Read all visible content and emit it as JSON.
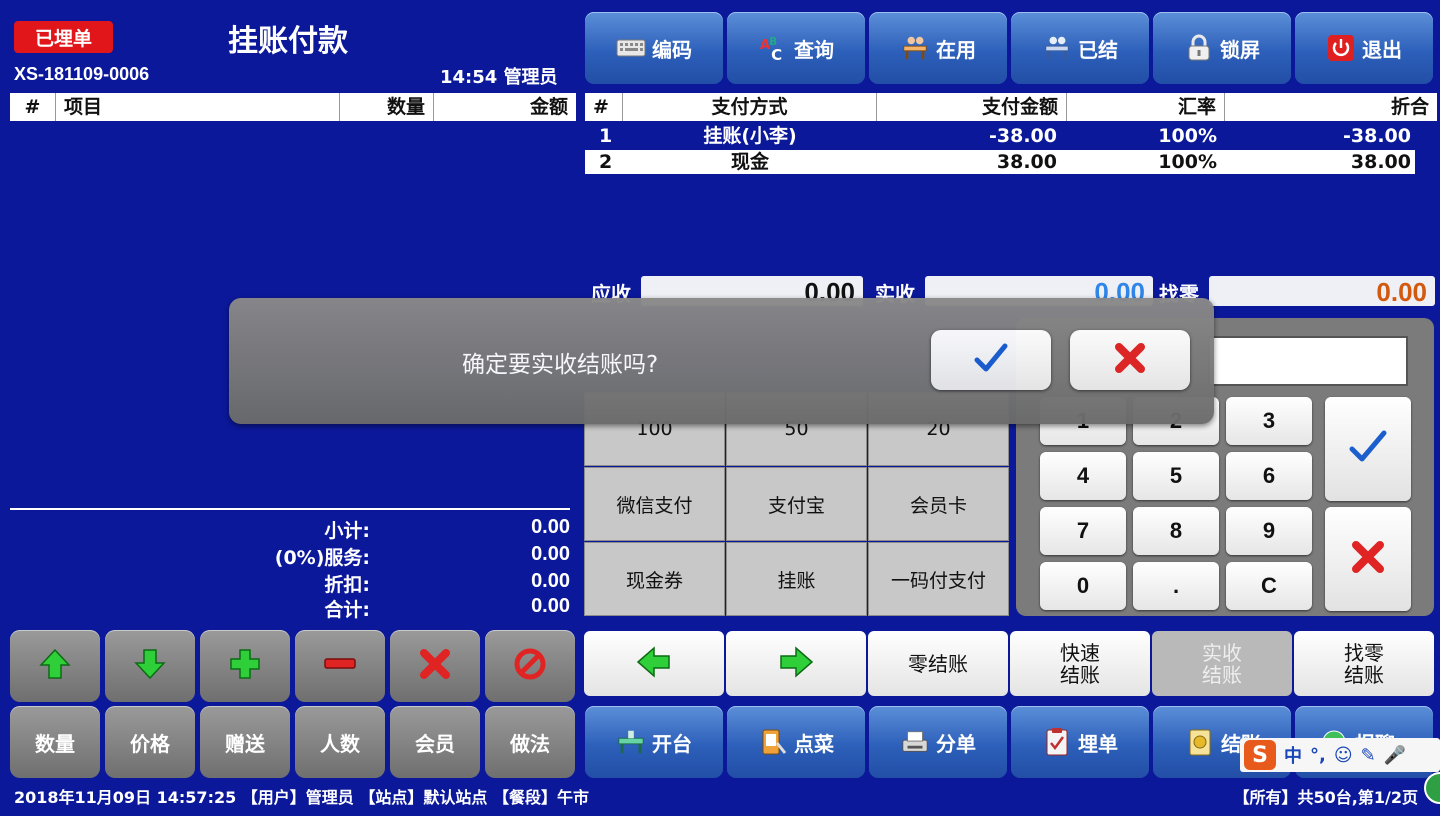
{
  "header": {
    "status_badge": "已埋单",
    "title": "挂账付款",
    "order_no": "XS-181109-0006",
    "time_user": "14:54 管理员"
  },
  "toolbar": [
    {
      "label": "编码",
      "icon": "keyboard-icon"
    },
    {
      "label": "查询",
      "icon": "abc-search-icon"
    },
    {
      "label": "在用",
      "icon": "table-in-use-icon"
    },
    {
      "label": "已结",
      "icon": "table-settled-icon"
    },
    {
      "label": "锁屏",
      "icon": "lock-icon"
    },
    {
      "label": "退出",
      "icon": "power-icon"
    }
  ],
  "item_table": {
    "columns": [
      "#",
      "项目",
      "数量",
      "金额"
    ]
  },
  "payment_table": {
    "columns": [
      "#",
      "支付方式",
      "支付金额",
      "汇率",
      "折合"
    ],
    "rows": [
      {
        "no": "1",
        "method": "挂账(小李)",
        "amount": "-38.00",
        "rate": "100%",
        "converted": "-38.00"
      },
      {
        "no": "2",
        "method": "现金",
        "amount": "38.00",
        "rate": "100%",
        "converted": "38.00"
      }
    ]
  },
  "amounts": {
    "receivable_label": "应收",
    "receivable": "0.00",
    "received_label": "实收",
    "received": "0.00",
    "change_label": "找零",
    "change": "0.00"
  },
  "quick_pay": {
    "cash_row": [
      "100",
      "50",
      "20"
    ],
    "methods": [
      "微信支付",
      "支付宝",
      "会员卡",
      "现金券",
      "挂账",
      "一码付支付"
    ]
  },
  "keypad": {
    "keys": [
      "1",
      "2",
      "3",
      "4",
      "5",
      "6",
      "7",
      "8",
      "9",
      "0",
      ".",
      "C"
    ]
  },
  "summary": {
    "subtotal_label": "小计:",
    "subtotal": "0.00",
    "service_label": "(0%)服务:",
    "service": "0.00",
    "discount_label": "折扣:",
    "discount": "0.00",
    "total_label": "合计:",
    "total": "0.00"
  },
  "edit_buttons": [
    "数量",
    "价格",
    "赠送",
    "人数",
    "会员",
    "做法"
  ],
  "action_buttons": {
    "zero_settle": "零结账",
    "quick_settle": "快速\n结账",
    "actual_settle": "实收\n结账",
    "change_settle": "找零\n结账"
  },
  "bottom_nav": [
    {
      "label": "开台",
      "icon": "open-table-icon"
    },
    {
      "label": "点菜",
      "icon": "order-icon"
    },
    {
      "label": "分单",
      "icon": "split-bill-icon"
    },
    {
      "label": "埋单",
      "icon": "bill-icon"
    },
    {
      "label": "结账",
      "icon": "checkout-icon"
    },
    {
      "label": "报聊",
      "icon": "report-icon"
    }
  ],
  "status_bar": {
    "left": "2018年11月09日 14:57:25 【用户】管理员 【站点】默认站点 【餐段】午市",
    "right": "【所有】共50台,第1/2页"
  },
  "dialog": {
    "message": "确定要实收结账吗?"
  },
  "ime": {
    "logo": "S",
    "mode": "中"
  },
  "colors": {
    "background": "#0b189a",
    "badge": "#e0161a",
    "received_value": "#2f86e8",
    "change_value": "#d2590e"
  }
}
